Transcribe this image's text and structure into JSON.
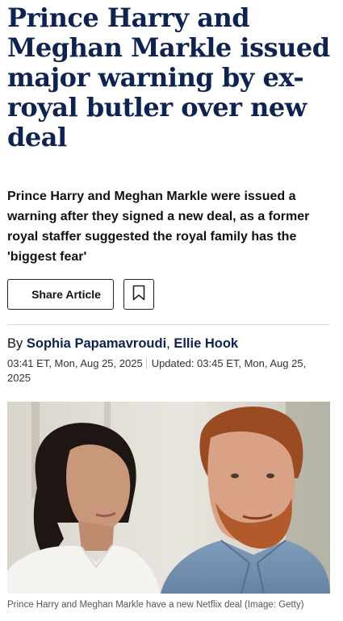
{
  "article": {
    "headline": "Prince Harry and Meghan Markle issued major warning by ex-royal butler over new deal",
    "standfirst": "Prince Harry and Meghan Markle were issued a warning after they signed a new deal, as a former royal staffer suggested the royal family has the 'biggest fear'",
    "actions": {
      "share_label": "Share Article",
      "bookmark_icon": "bookmark-icon"
    },
    "byline": {
      "prefix": "By",
      "authors": [
        "Sophia Papamavroudi",
        "Ellie Hook"
      ],
      "separator": ","
    },
    "dates": {
      "published": "03:41 ET, Mon, Aug 25, 2025",
      "updated": "Updated: 03:45 ET, Mon, Aug 25, 2025"
    },
    "image": {
      "caption": "Prince Harry and Meghan Markle have a new Netflix deal (Image: Getty)"
    }
  },
  "colors": {
    "headline": "#0f2350",
    "author_link": "#0f2350",
    "divider": "#dddddd"
  }
}
